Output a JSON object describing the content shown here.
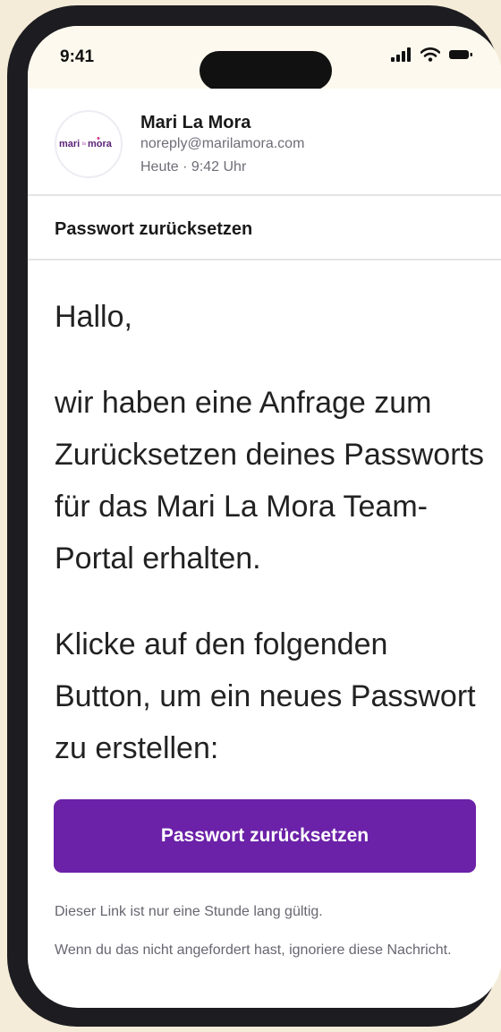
{
  "status_bar": {
    "time": "9:41",
    "icons": [
      "signal-icon",
      "wifi-icon",
      "battery-icon"
    ]
  },
  "email": {
    "sender_logo_text": "mari la mora",
    "sender_name": "Mari La Mora",
    "sender_email": "noreply@marilamora.com",
    "date": "Heute · 9:42 Uhr",
    "subject": "Passwort zurücksetzen",
    "greeting": "Hallo,",
    "paragraph_1": "wir haben eine Anfrage zum Zurücksetzen deines Passworts für das Mari La Mora Team-Portal erhalten.",
    "paragraph_2": "Klicke auf den folgenden Button, um ein neues Passwort zu erstellen:",
    "cta_label": "Passwort zurücksetzen",
    "note_1": "Dieser Link ist nur eine Stunde lang gültig.",
    "note_2": "Wenn du das nicht angefordert hast, ignoriere diese Nachricht."
  },
  "colors": {
    "page_background": "#f4ecd8",
    "accent": "#6b21a8",
    "logo_purple": "#5b2176"
  }
}
